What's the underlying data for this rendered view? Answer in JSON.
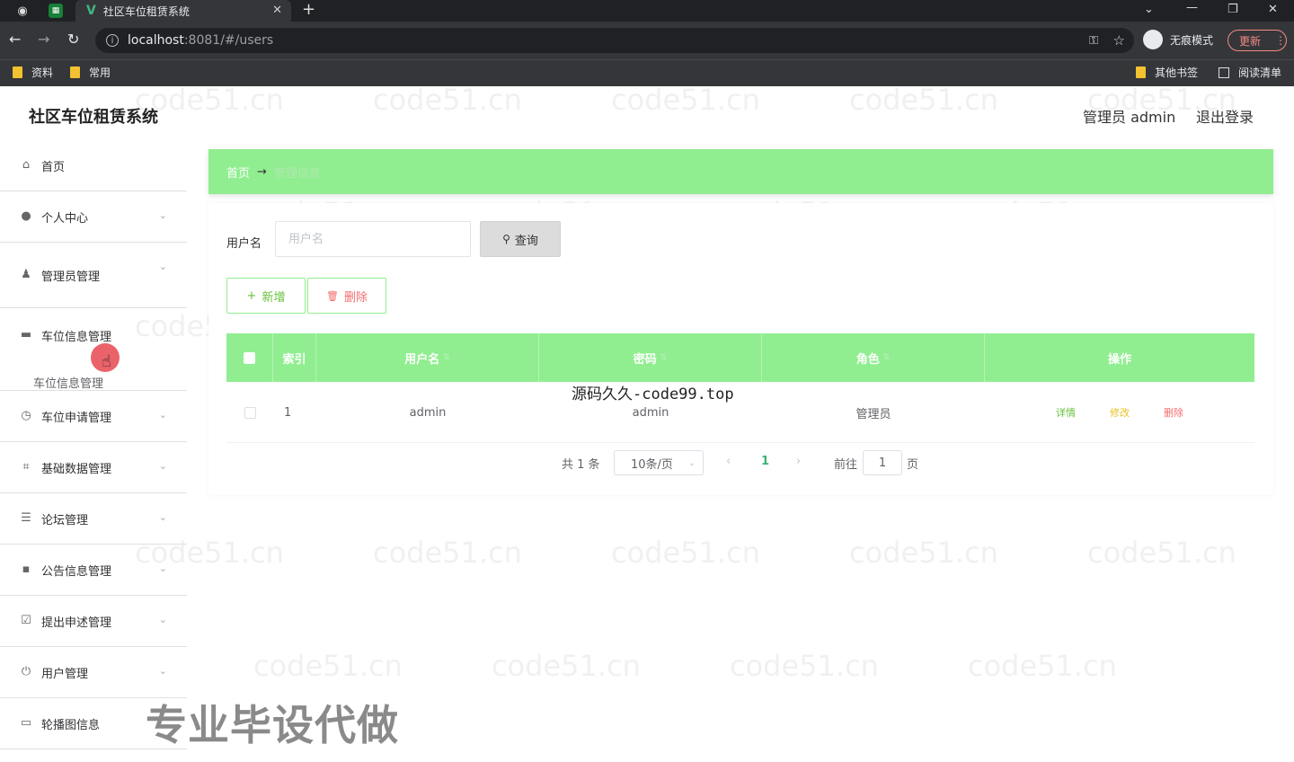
{
  "browser": {
    "tab_title": "社区车位租赁系统",
    "url_host": "localhost",
    "url_path": ":8081/#/users",
    "incognito_label": "无痕模式",
    "update_label": "更新",
    "bookmarks": [
      "资料",
      "常用"
    ],
    "bookmarks_right": [
      "其他书签",
      "阅读清单"
    ]
  },
  "header": {
    "app_title": "社区车位租赁系统",
    "user_label": "管理员 admin",
    "logout_label": "退出登录"
  },
  "sidebar": {
    "items": [
      {
        "label": "首页",
        "icon": "home-icon"
      },
      {
        "label": "个人中心",
        "icon": "user-icon"
      },
      {
        "label": "管理员管理",
        "icon": "admin-icon"
      },
      {
        "label": "车位信息管理",
        "icon": "parking-icon"
      },
      {
        "label": "车位申请管理",
        "icon": "apply-icon"
      },
      {
        "label": "基础数据管理",
        "icon": "data-icon"
      },
      {
        "label": "论坛管理",
        "icon": "forum-icon"
      },
      {
        "label": "公告信息管理",
        "icon": "notice-icon"
      },
      {
        "label": "提出申述管理",
        "icon": "complaint-icon"
      },
      {
        "label": "用户管理",
        "icon": "power-icon"
      },
      {
        "label": "轮播图信息",
        "icon": "carousel-icon"
      }
    ],
    "sub_item": "车位信息管理"
  },
  "breadcrumb": {
    "home": "首页",
    "separator": "→",
    "current": "管理信息"
  },
  "search": {
    "label": "用户名",
    "placeholder": "用户名",
    "button_label": "查询"
  },
  "actions": {
    "add_label": "新增",
    "delete_label": "删除"
  },
  "table": {
    "columns": [
      "索引",
      "用户名",
      "密码",
      "角色",
      "操作"
    ],
    "rows": [
      {
        "index": "1",
        "username": "admin",
        "password": "admin",
        "role": "管理员"
      }
    ],
    "row_actions": {
      "detail": "详情",
      "edit": "修改",
      "delete": "删除"
    }
  },
  "pagination": {
    "total_text": "共 1 条",
    "page_size": "10条/页",
    "current_page": "1",
    "goto_label": "前往",
    "goto_value": "1",
    "page_suffix": "页"
  },
  "overlays": {
    "caption_top": "源码久久-code99.top",
    "caption_big": "专业毕设代做",
    "watermark": "code51.cn"
  },
  "colors": {
    "accent": "#90ee90",
    "chrome_dark": "#202124",
    "detail": "#67c23a",
    "edit": "#e6c229",
    "delete": "#f56c6c"
  }
}
